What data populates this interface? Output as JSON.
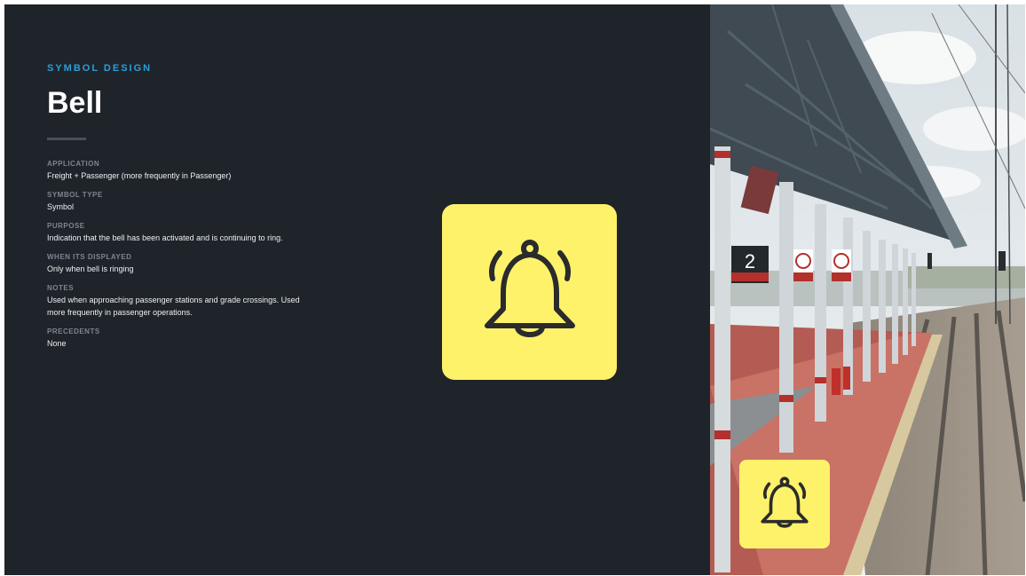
{
  "header": {
    "eyebrow": "SYMBOL DESIGN",
    "title": "Bell"
  },
  "specs": [
    {
      "label": "APPLICATION",
      "value": "Freight + Passenger (more frequently in Passenger)"
    },
    {
      "label": "SYMBOL TYPE",
      "value": "Symbol"
    },
    {
      "label": "PURPOSE",
      "value": "Indication that the bell has been activated and is continuing to ring."
    },
    {
      "label": "WHEN ITS DISPLAYED",
      "value": "Only when bell is ringing"
    },
    {
      "label": "NOTES",
      "value": "Used when approaching passenger stations and grade crossings. Used more frequently in passenger operations."
    },
    {
      "label": "PRECEDENTS",
      "value": "None"
    }
  ],
  "photo": {
    "platform_number": "2"
  },
  "icons": {
    "main": "bell-ringing-icon",
    "overlay": "bell-ringing-icon"
  },
  "colors": {
    "background": "#1f242b",
    "accent": "#2a9fd6",
    "symbol_tile": "#fdf26a",
    "symbol_stroke": "#2b2b2b"
  }
}
